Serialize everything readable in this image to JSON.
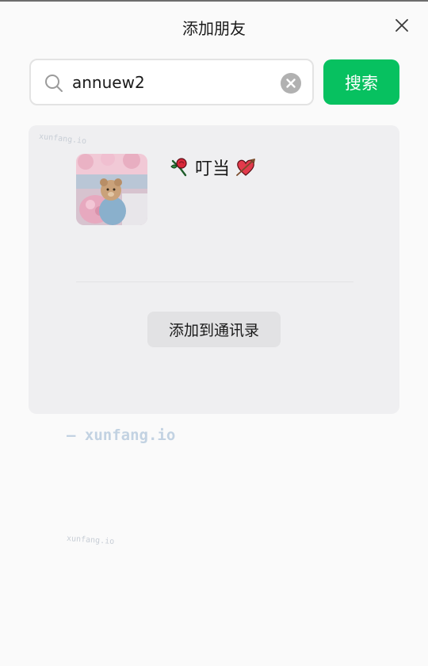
{
  "window": {
    "title": "添加朋友"
  },
  "search": {
    "value": "annuew2",
    "button_label": "搜索"
  },
  "result": {
    "name": "叮当",
    "add_button_label": "添加到通讯录"
  },
  "watermark": {
    "small_top": "xunfang.io",
    "large": "— xunfang.io",
    "small_bottom": "xunfang.io"
  },
  "colors": {
    "accent": "#07c160",
    "background": "#fafafa",
    "card": "#efeff1",
    "clear_button": "#b1b1b1"
  },
  "icons": {
    "close": "close-icon",
    "search": "search-icon",
    "clear": "clear-icon",
    "name_prefix": "rose-icon",
    "name_suffix": "heart-arrow-icon"
  }
}
